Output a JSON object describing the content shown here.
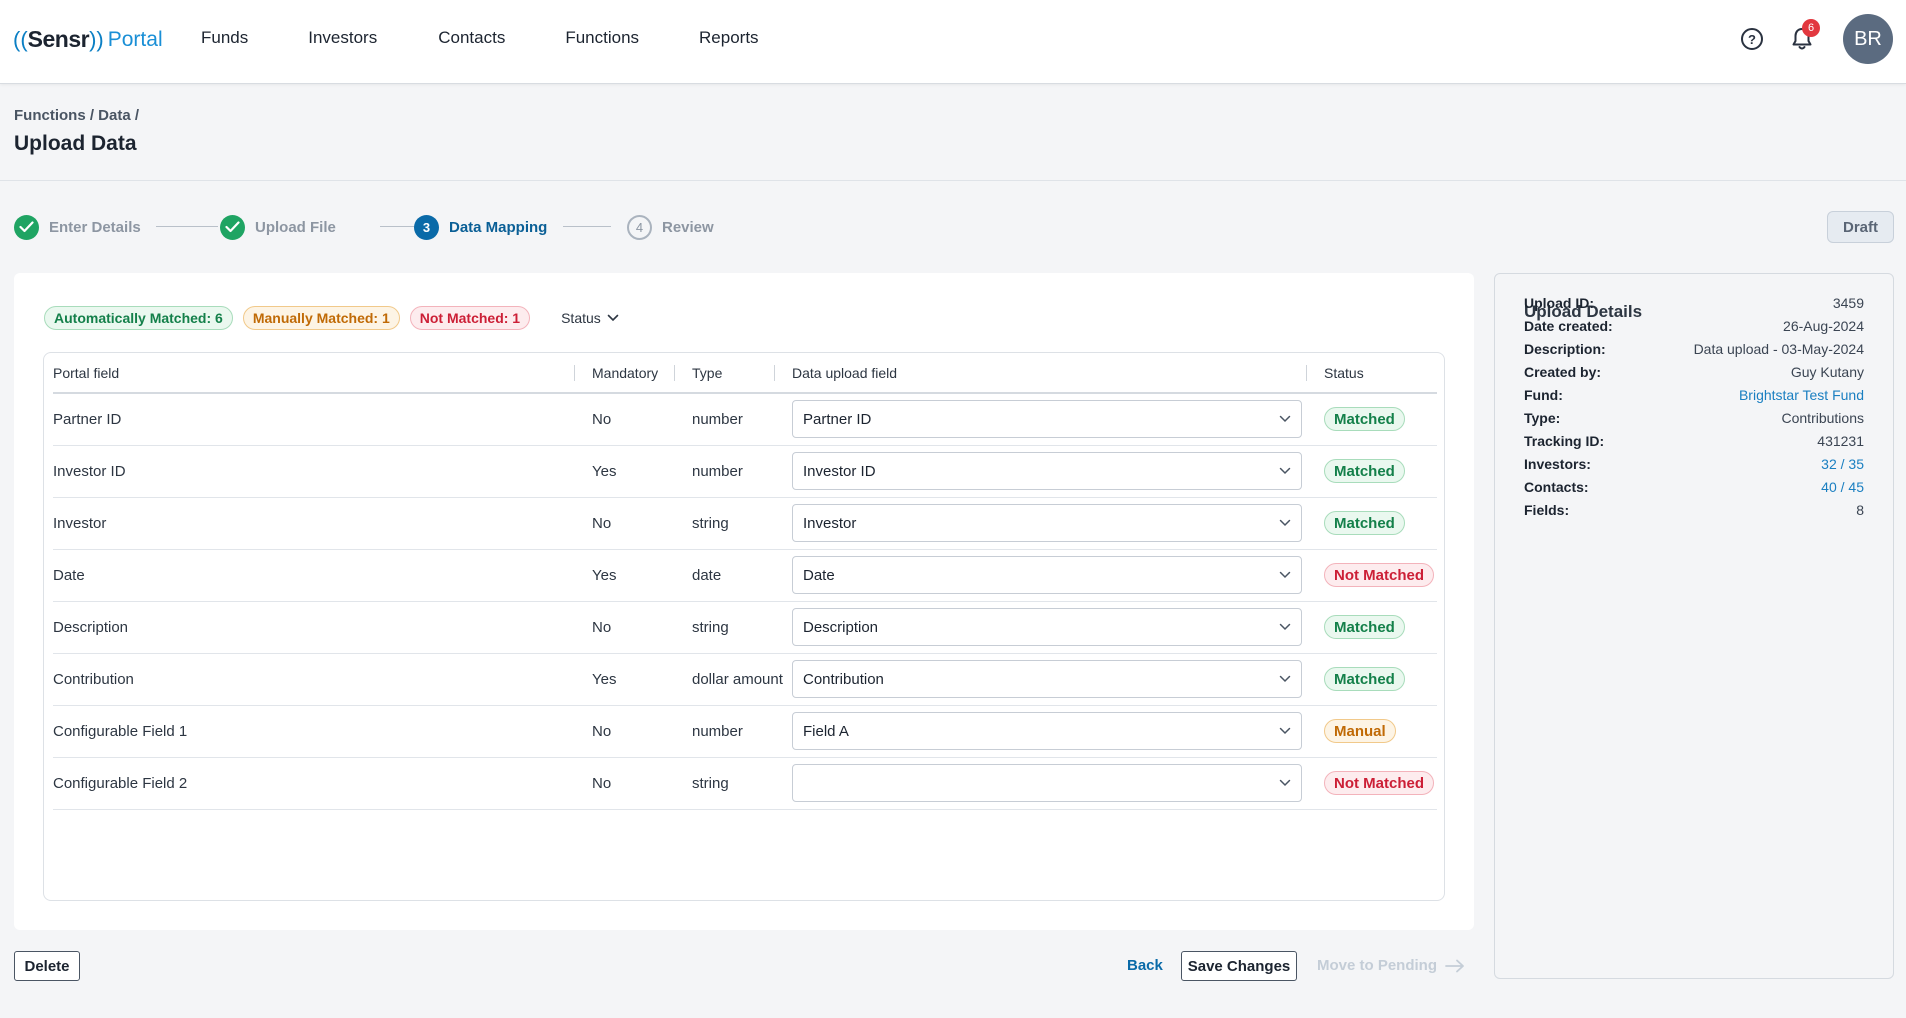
{
  "app": {
    "logo_left": "((",
    "logo_name": "Sensr",
    "logo_right": "))",
    "logo_suffix": "Portal"
  },
  "nav": [
    "Funds",
    "Investors",
    "Contacts",
    "Functions",
    "Reports"
  ],
  "header": {
    "help_icon": "?",
    "notification_count": "6",
    "avatar_initials": "BR"
  },
  "breadcrumb": "Functions / Data /",
  "page_title": "Upload Data",
  "stepper": {
    "steps": [
      {
        "label": "Enter Details",
        "state": "done",
        "number": ""
      },
      {
        "label": "Upload File",
        "state": "done",
        "number": ""
      },
      {
        "label": "Data Mapping",
        "state": "active",
        "number": "3"
      },
      {
        "label": "Review",
        "state": "todo",
        "number": "4"
      }
    ],
    "draft_label": "Draft"
  },
  "summary": {
    "auto": "Automatically Matched: 6",
    "manual": "Manually Matched: 1",
    "not_matched": "Not Matched: 1",
    "status_filter": "Status"
  },
  "table": {
    "headers": [
      "Portal field",
      "Mandatory",
      "Type",
      "Data upload field",
      "Status"
    ],
    "rows": [
      {
        "portal": "Partner ID",
        "mandatory": "No",
        "type": "number",
        "upload": "Partner ID",
        "status": "Matched",
        "kind": "matched"
      },
      {
        "portal": "Investor ID",
        "mandatory": "Yes",
        "type": "number",
        "upload": "Investor ID",
        "status": "Matched",
        "kind": "matched"
      },
      {
        "portal": "Investor",
        "mandatory": "No",
        "type": "string",
        "upload": "Investor",
        "status": "Matched",
        "kind": "matched"
      },
      {
        "portal": "Date",
        "mandatory": "Yes",
        "type": "date",
        "upload": "Date",
        "status": "Not Matched",
        "kind": "notmatched"
      },
      {
        "portal": "Description",
        "mandatory": "No",
        "type": "string",
        "upload": "Description",
        "status": "Matched",
        "kind": "matched"
      },
      {
        "portal": "Contribution",
        "mandatory": "Yes",
        "type": "dollar amount",
        "upload": "Contribution",
        "status": "Matched",
        "kind": "matched"
      },
      {
        "portal": "Configurable Field 1",
        "mandatory": "No",
        "type": "number",
        "upload": "Field A",
        "status": "Manual",
        "kind": "manual"
      },
      {
        "portal": "Configurable Field 2",
        "mandatory": "No",
        "type": "string",
        "upload": "",
        "status": "Not Matched",
        "kind": "notmatched"
      }
    ]
  },
  "actions": {
    "delete": "Delete",
    "back": "Back",
    "save": "Save Changes",
    "move": "Move to Pending"
  },
  "details": {
    "title": "Upload Details",
    "rows": [
      {
        "label": "Upload ID:",
        "value": "3459",
        "link": false
      },
      {
        "label": "Date created:",
        "value": "26-Aug-2024",
        "link": false
      },
      {
        "label": "Description:",
        "value": "Data upload - 03-May-2024",
        "link": false
      },
      {
        "label": "Created by:",
        "value": "Guy Kutany",
        "link": false
      },
      {
        "label": "Fund:",
        "value": "Brightstar Test Fund",
        "link": true
      },
      {
        "label": "Type:",
        "value": "Contributions",
        "link": false
      },
      {
        "label": "Tracking ID:",
        "value": "431231",
        "link": false
      },
      {
        "label": "Investors:",
        "value": "32 / 35",
        "link": true
      },
      {
        "label": "Contacts:",
        "value": "40 / 45",
        "link": true
      },
      {
        "label": "Fields:",
        "value": "8",
        "link": false
      }
    ]
  },
  "colors": {
    "accent": "#0a6aa8",
    "matched": "#14804a",
    "not_matched": "#cc1f36",
    "manual": "#c06a06"
  }
}
